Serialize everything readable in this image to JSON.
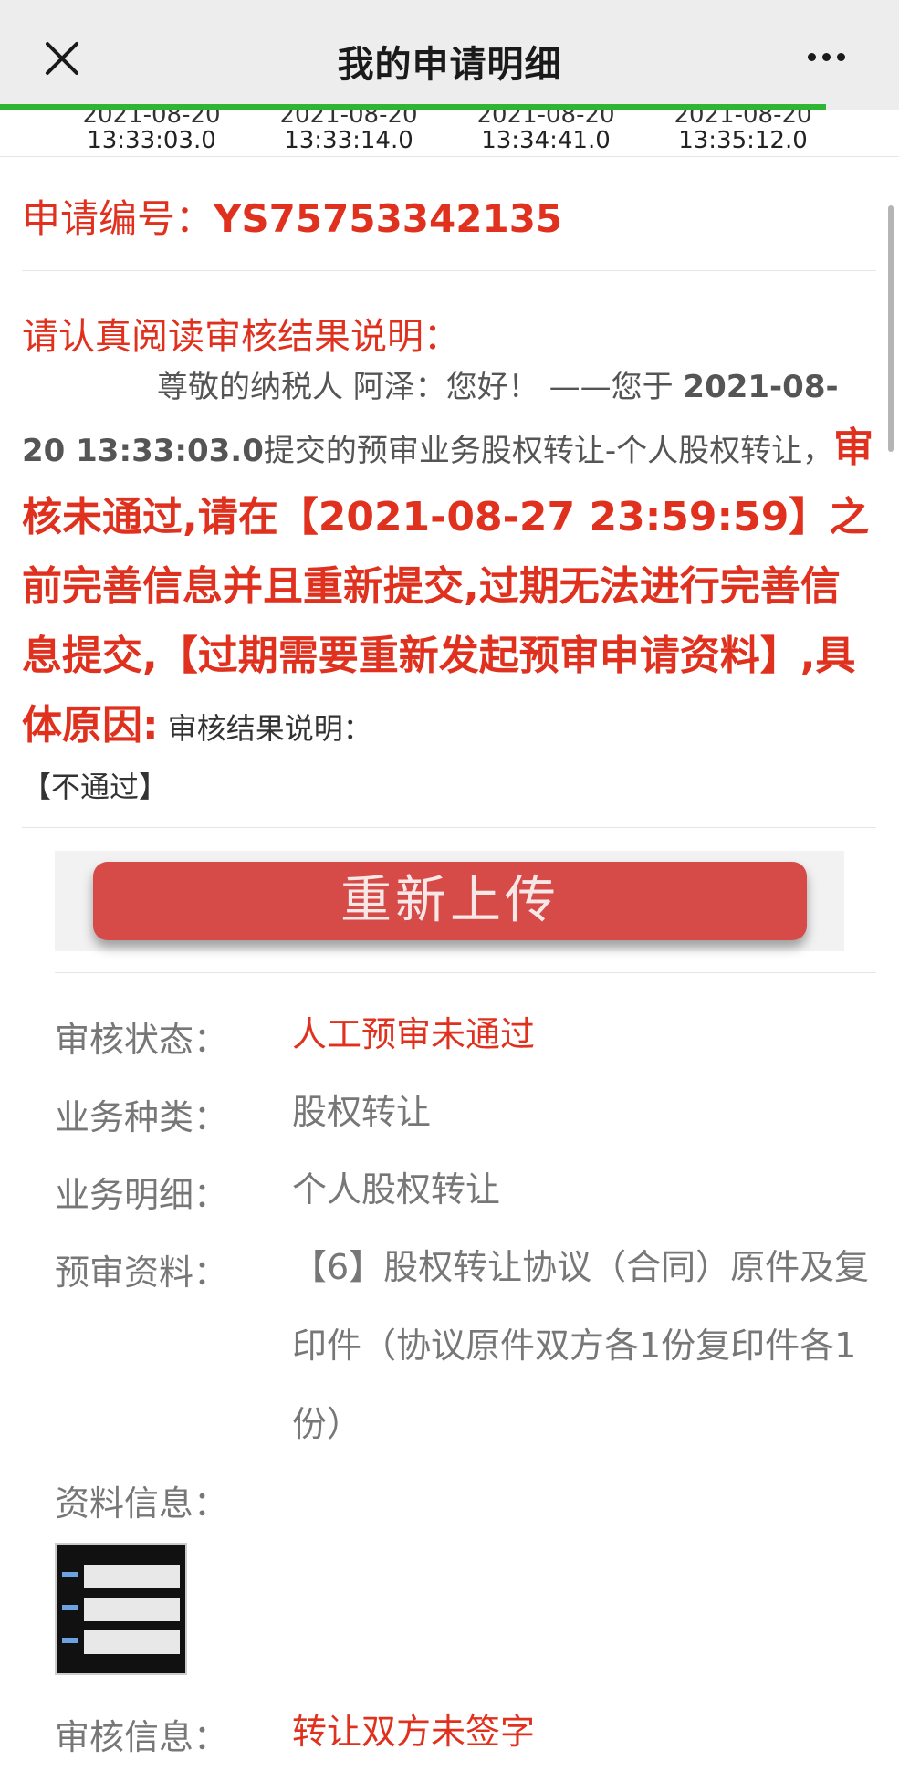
{
  "header": {
    "title": "我的申请明细",
    "close_icon": "close-icon",
    "more_icon": "more-icon"
  },
  "progress_percent": 92,
  "timeline": {
    "dates": [
      "2021-08-20",
      "2021-08-20",
      "2021-08-20",
      "2021-08-20"
    ],
    "times": [
      "13:33:03.0",
      "13:33:14.0",
      "13:34:41.0",
      "13:35:12.0"
    ]
  },
  "application": {
    "number_label": "申请编号：",
    "number": "YS75753342135"
  },
  "notice": {
    "title": "请认真阅读审核结果说明：",
    "greeting": "尊敬的纳税人 阿泽：您好！ ——您于 ",
    "submit_time": "2021-08-20 13:33:03.0",
    "body_mid": "提交的预审业务股权转让-个人股权转让，",
    "warning": "审核未通过,请在【2021-08-27 23:59:59】之前完善信息并且重新提交,过期无法进行完善信息提交,【过期需要重新发起预审申请资料】,具体原因:",
    "result_label": " 审核结果说明：",
    "result_value": "【不通过】"
  },
  "reupload_button": "重新上传",
  "details": {
    "status_label": "审核状态：",
    "status_value": "人工预审未通过",
    "type_label": "业务种类：",
    "type_value": "股权转让",
    "detail_label": "业务明细：",
    "detail_value": "个人股权转让",
    "material_label": "预审资料：",
    "material_value": "【6】股权转让协议（合同）原件及复印件（协议原件双方各1份复印件各1份）",
    "info_label": "资料信息：",
    "review_label": "审核信息：",
    "review_value": "转让双方未签字"
  },
  "colors": {
    "accent_red": "#e0301e",
    "button_red": "#d64b47",
    "progress_green": "#2fb533"
  }
}
